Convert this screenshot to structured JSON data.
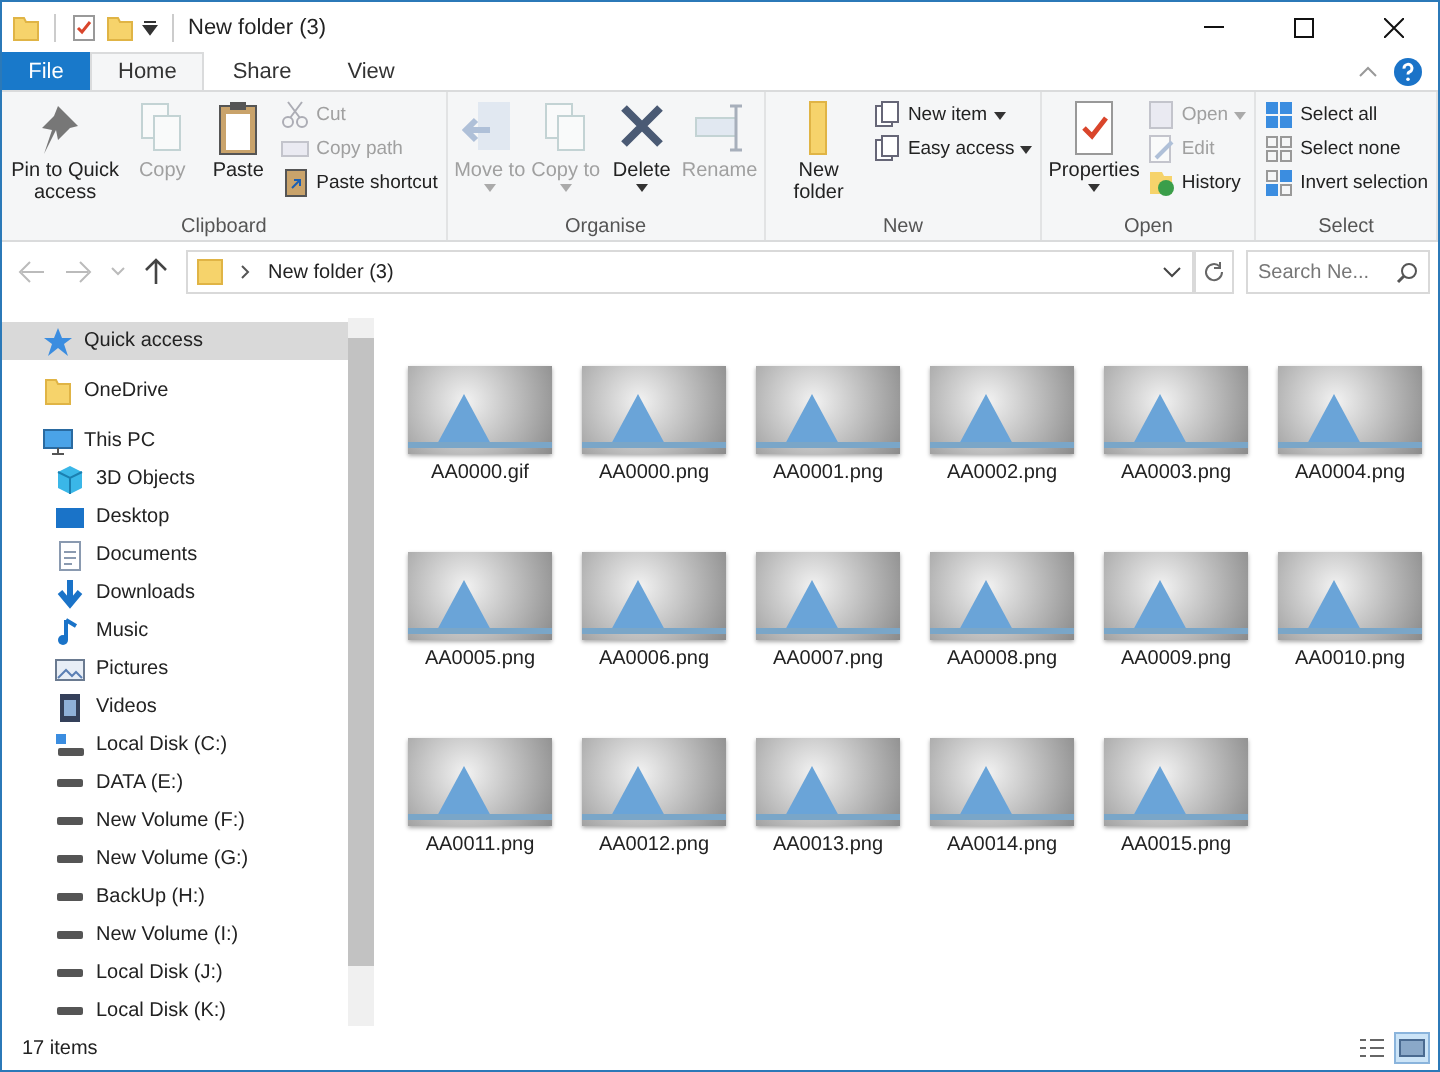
{
  "window": {
    "title": "New folder (3)"
  },
  "tabs": [
    {
      "label": "File",
      "kind": "file",
      "selected": false
    },
    {
      "label": "Home",
      "kind": "tab",
      "selected": true
    },
    {
      "label": "Share",
      "kind": "tab",
      "selected": false
    },
    {
      "label": "View",
      "kind": "tab",
      "selected": false
    }
  ],
  "ribbon": {
    "groups": [
      {
        "label": "Clipboard",
        "items": [
          {
            "kind": "large",
            "label": "Pin to Quick access",
            "disabled": false
          },
          {
            "kind": "large",
            "label": "Copy",
            "disabled": true
          },
          {
            "kind": "large",
            "label": "Paste",
            "disabled": false
          },
          {
            "kind": "stack",
            "items": [
              {
                "label": "Cut",
                "disabled": true
              },
              {
                "label": "Copy path",
                "disabled": true
              },
              {
                "label": "Paste shortcut",
                "disabled": false
              }
            ]
          }
        ]
      },
      {
        "label": "Organise",
        "items": [
          {
            "kind": "large",
            "label": "Move to",
            "dropdown": true,
            "disabled": true
          },
          {
            "kind": "large",
            "label": "Copy to",
            "dropdown": true,
            "disabled": true
          },
          {
            "kind": "large",
            "label": "Delete",
            "dropdown": true,
            "disabled": false
          },
          {
            "kind": "large",
            "label": "Rename",
            "disabled": true
          }
        ]
      },
      {
        "label": "New",
        "items": [
          {
            "kind": "large",
            "label": "New folder",
            "disabled": false
          },
          {
            "kind": "stack",
            "items": [
              {
                "label": "New item",
                "dropdown": true,
                "disabled": false
              },
              {
                "label": "Easy access",
                "dropdown": true,
                "disabled": false
              }
            ]
          }
        ]
      },
      {
        "label": "Open",
        "items": [
          {
            "kind": "large",
            "label": "Properties",
            "dropdown": true,
            "disabled": false
          },
          {
            "kind": "stack",
            "items": [
              {
                "label": "Open",
                "dropdown": true,
                "disabled": true
              },
              {
                "label": "Edit",
                "disabled": true
              },
              {
                "label": "History",
                "disabled": false
              }
            ]
          }
        ]
      },
      {
        "label": "Select",
        "items": [
          {
            "kind": "stack",
            "items": [
              {
                "label": "Select all",
                "disabled": false
              },
              {
                "label": "Select none",
                "disabled": false
              },
              {
                "label": "Invert selection",
                "disabled": false
              }
            ]
          }
        ]
      }
    ]
  },
  "address_bar": {
    "path": "New folder (3)"
  },
  "search": {
    "placeholder": "Search Ne..."
  },
  "sidebar": {
    "items": [
      {
        "label": "Quick access",
        "selected": true
      },
      {
        "label": "OneDrive",
        "selected": false
      },
      {
        "label": "This PC",
        "selected": false,
        "children": [
          {
            "label": "3D Objects",
            "selected": false
          },
          {
            "label": "Desktop",
            "selected": false
          },
          {
            "label": "Documents",
            "selected": false
          },
          {
            "label": "Downloads",
            "selected": false
          },
          {
            "label": "Music",
            "selected": false
          },
          {
            "label": "Pictures",
            "selected": false
          },
          {
            "label": "Videos",
            "selected": false
          },
          {
            "label": "Local Disk (C:)",
            "selected": false
          },
          {
            "label": "DATA (E:)",
            "selected": false
          },
          {
            "label": "New Volume (F:)",
            "selected": false
          },
          {
            "label": "New Volume (G:)",
            "selected": false
          },
          {
            "label": "BackUp (H:)",
            "selected": false
          },
          {
            "label": "New Volume (I:)",
            "selected": false
          },
          {
            "label": "Local Disk (J:)",
            "selected": false
          },
          {
            "label": "Local Disk (K:)",
            "selected": false
          }
        ]
      }
    ]
  },
  "files": [
    {
      "name": "AA0000.gif"
    },
    {
      "name": "AA0000.png"
    },
    {
      "name": "AA0001.png"
    },
    {
      "name": "AA0002.png"
    },
    {
      "name": "AA0003.png"
    },
    {
      "name": "AA0004.png"
    },
    {
      "name": "AA0005.png"
    },
    {
      "name": "AA0006.png"
    },
    {
      "name": "AA0007.png"
    },
    {
      "name": "AA0008.png"
    },
    {
      "name": "AA0009.png"
    },
    {
      "name": "AA0010.png"
    },
    {
      "name": "AA0011.png"
    },
    {
      "name": "AA0012.png"
    },
    {
      "name": "AA0013.png"
    },
    {
      "name": "AA0014.png"
    },
    {
      "name": "AA0015.png"
    }
  ],
  "status_bar": {
    "text": "17 items"
  },
  "view_buttons": [
    {
      "kind": "details",
      "selected": false
    },
    {
      "kind": "large_icons",
      "selected": true
    }
  ]
}
